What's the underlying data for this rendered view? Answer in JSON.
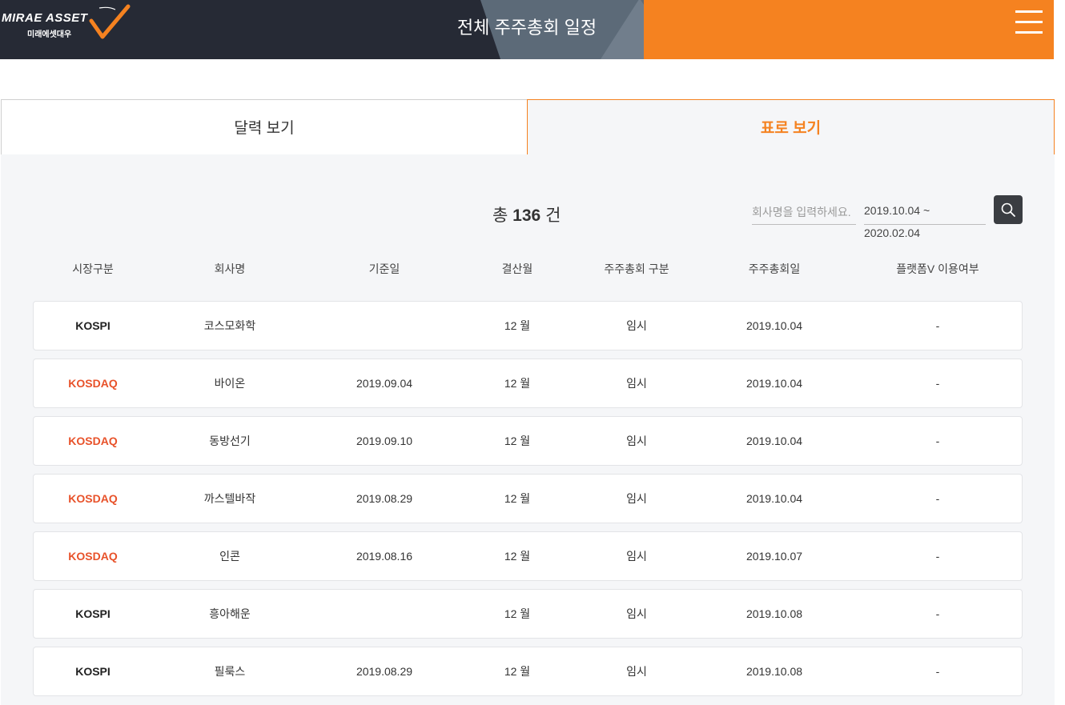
{
  "header": {
    "logo_text": "MIRAE ASSET",
    "logo_text_ko": "미래에셋대우",
    "title": "전체 주주총회 일정",
    "menu_icon": "hamburger-menu-icon"
  },
  "tabs": [
    {
      "label": "달력 보기",
      "active": false
    },
    {
      "label": "표로 보기",
      "active": true
    }
  ],
  "summary": {
    "prefix": "총",
    "count": "136",
    "suffix": "건"
  },
  "search": {
    "placeholder": "회사명을 입력하세요.",
    "date_range": "2019.10.04 ~ 2020.02.04",
    "button_icon": "search-icon"
  },
  "table": {
    "columns": [
      "시장구분",
      "회사명",
      "기준일",
      "결산월",
      "주주총회 구분",
      "주주총회일",
      "플랫폼V 이용여부"
    ],
    "rows": [
      {
        "market": "KOSPI",
        "company": "코스모화학",
        "record_date": "",
        "fiscal_month": "12 월",
        "meeting_type": "임시",
        "meeting_date": "2019.10.04",
        "platform_v": "-"
      },
      {
        "market": "KOSDAQ",
        "company": "바이온",
        "record_date": "2019.09.04",
        "fiscal_month": "12 월",
        "meeting_type": "임시",
        "meeting_date": "2019.10.04",
        "platform_v": "-"
      },
      {
        "market": "KOSDAQ",
        "company": "동방선기",
        "record_date": "2019.09.10",
        "fiscal_month": "12 월",
        "meeting_type": "임시",
        "meeting_date": "2019.10.04",
        "platform_v": "-"
      },
      {
        "market": "KOSDAQ",
        "company": "까스텔바작",
        "record_date": "2019.08.29",
        "fiscal_month": "12 월",
        "meeting_type": "임시",
        "meeting_date": "2019.10.04",
        "platform_v": "-"
      },
      {
        "market": "KOSDAQ",
        "company": "인콘",
        "record_date": "2019.08.16",
        "fiscal_month": "12 월",
        "meeting_type": "임시",
        "meeting_date": "2019.10.07",
        "platform_v": "-"
      },
      {
        "market": "KOSPI",
        "company": "흥아해운",
        "record_date": "",
        "fiscal_month": "12 월",
        "meeting_type": "임시",
        "meeting_date": "2019.10.08",
        "platform_v": "-"
      },
      {
        "market": "KOSPI",
        "company": "필룩스",
        "record_date": "2019.08.29",
        "fiscal_month": "12 월",
        "meeting_type": "임시",
        "meeting_date": "2019.10.08",
        "platform_v": "-"
      }
    ]
  },
  "colors": {
    "accent": "#f58220",
    "header_bg": "#262a35",
    "kosdaq": "#e8522a",
    "kospi": "#222222"
  }
}
